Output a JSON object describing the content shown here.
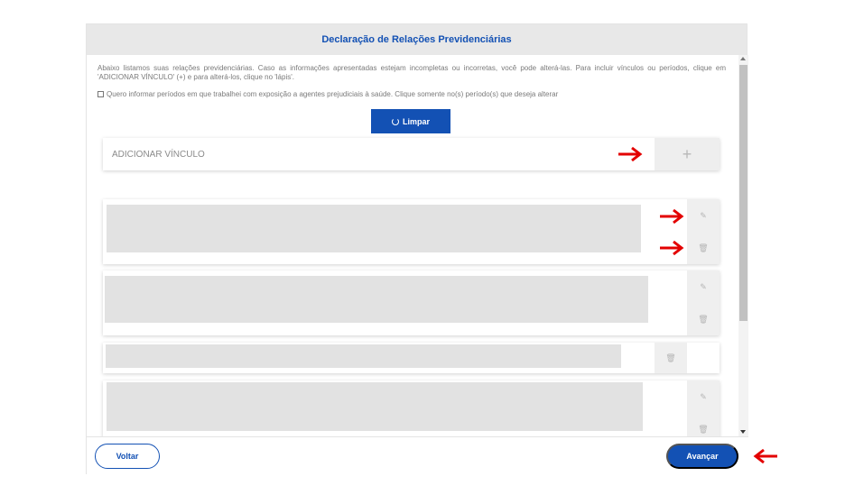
{
  "dialog": {
    "title": "Declaração de Relações Previdenciárias"
  },
  "intro": {
    "text": "Abaixo listamos suas relações previdenciárias. Caso as informações apresentadas estejam incompletas ou incorretas, você pode alterá-las. Para incluir vínculos ou períodos, clique em 'ADICIONAR VÍNCULO' (+) e para alterá-los, clique no 'lápis'."
  },
  "exposure_option": {
    "label": "Quero informar períodos em que trabalhei com exposição a agentes prejudiciais à saúde. Clique somente no(s) período(s) que deseja alterar",
    "checked": false
  },
  "toolbar": {
    "clear_label": "Limpar"
  },
  "add_vinculo": {
    "label": "ADICIONAR VÍNCULO",
    "icon": "plus-icon"
  },
  "vinculos": [
    {
      "content": "",
      "actions": [
        "pencil-icon",
        "trash-icon"
      ]
    },
    {
      "content": "",
      "actions": [
        "pencil-icon",
        "trash-icon"
      ]
    },
    {
      "content": "",
      "actions": [
        "trash-icon"
      ]
    },
    {
      "content": "",
      "actions": [
        "pencil-icon",
        "trash-icon"
      ]
    }
  ],
  "footer": {
    "back_label": "Voltar",
    "next_label": "Avançar"
  },
  "colors": {
    "primary": "#1351b4",
    "annotation_arrow": "#e30000"
  }
}
